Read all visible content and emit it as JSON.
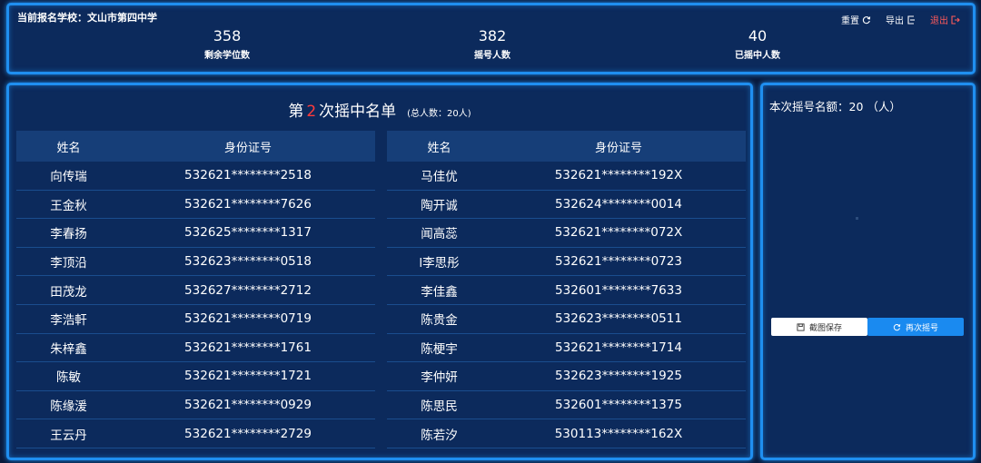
{
  "header": {
    "school_label": "当前报名学校：文山市第四中学",
    "actions": {
      "reset": "重置",
      "export": "导出",
      "exit": "退出"
    },
    "stats": [
      {
        "value": "358",
        "label": "剩余学位数"
      },
      {
        "value": "382",
        "label": "摇号人数"
      },
      {
        "value": "40",
        "label": "已摇中人数"
      }
    ]
  },
  "list": {
    "title_prefix": "第",
    "round": "2",
    "title_suffix": "次摇中名单",
    "total": "(总人数：20人)",
    "col_name": "姓名",
    "col_id": "身份证号",
    "left_rows": [
      {
        "name": "向传瑞",
        "id": "532621********2518"
      },
      {
        "name": "王金秋",
        "id": "532621********7626"
      },
      {
        "name": "李春扬",
        "id": "532625********1317"
      },
      {
        "name": "李顶沿",
        "id": "532623********0518"
      },
      {
        "name": "田茂龙",
        "id": "532627********2712"
      },
      {
        "name": "李浩軒",
        "id": "532621********0719"
      },
      {
        "name": "朱梓鑫",
        "id": "532621********1761"
      },
      {
        "name": "陈敏",
        "id": "532621********1721"
      },
      {
        "name": "陈缘湲",
        "id": "532621********0929"
      },
      {
        "name": "王云丹",
        "id": "532621********2729"
      }
    ],
    "right_rows": [
      {
        "name": "马佳优",
        "id": "532621********192X"
      },
      {
        "name": "陶开诚",
        "id": "532624********0014"
      },
      {
        "name": "闻高蕊",
        "id": "532621********072X"
      },
      {
        "name": "l李思彤",
        "id": "532621********0723"
      },
      {
        "name": "李佳鑫",
        "id": "532601********7633"
      },
      {
        "name": "陈贵金",
        "id": "532623********0511"
      },
      {
        "name": "陈梗宇",
        "id": "532621********1714"
      },
      {
        "name": "李仲妍",
        "id": "532623********1925"
      },
      {
        "name": "陈思民",
        "id": "532601********1375"
      },
      {
        "name": "陈若汐",
        "id": "530113********162X"
      }
    ]
  },
  "side": {
    "quota_label": "本次摇号名额：20 （人）",
    "save_button": "截图保存",
    "again_button": "再次摇号"
  },
  "icons": {
    "reset": "refresh-icon",
    "export": "export-icon",
    "exit": "logout-icon",
    "save": "save-icon",
    "again": "refresh-icon"
  },
  "colors": {
    "accent": "#1f8ff0",
    "highlight": "#ff3b3b",
    "exit": "#ff5a5a",
    "panel": "#0c2a5c"
  }
}
